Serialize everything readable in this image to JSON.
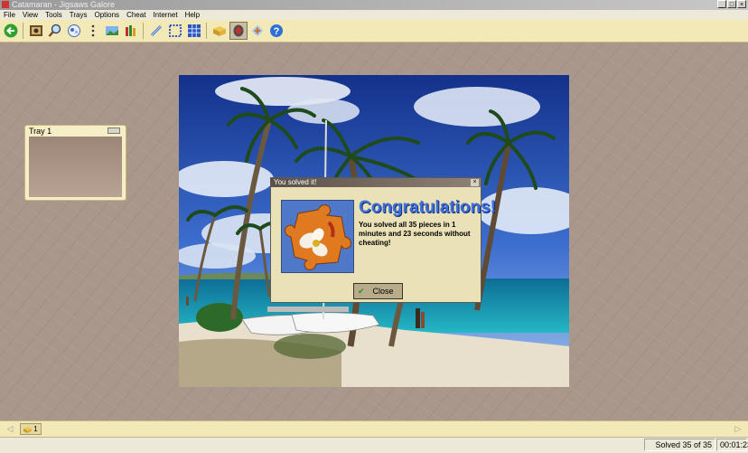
{
  "window": {
    "title": "Catamaran - Jigsaws Galore"
  },
  "menu": [
    "File",
    "View",
    "Tools",
    "Trays",
    "Options",
    "Cheat",
    "Internet",
    "Help"
  ],
  "toolbar": {
    "icons": [
      "back-arrow-icon",
      "picture-icon",
      "zoom-icon",
      "scatter-icon",
      "dots-icon",
      "landscape-icon",
      "pencils-icon",
      "link-icon",
      "edge-select-icon",
      "grid-select-icon",
      "box-icon",
      "ghost-icon",
      "share-icon",
      "help-icon"
    ],
    "active": "ghost-icon"
  },
  "tray": {
    "title": "Tray 1"
  },
  "dialog": {
    "title": "You solved it!",
    "close_glyph": "×",
    "heading": "Congratulations!",
    "message": "You solved all 35 pieces in 1 minutes and 23 seconds without cheating!",
    "button": "Close"
  },
  "bottom": {
    "tray_count": "1"
  },
  "status": {
    "solved": "Solved 35 of 35",
    "time": "00:01:23"
  },
  "colors": {
    "accent": "#3f6fd8",
    "toolbar": "#f3e9b7",
    "workspace": "#a8978a"
  }
}
